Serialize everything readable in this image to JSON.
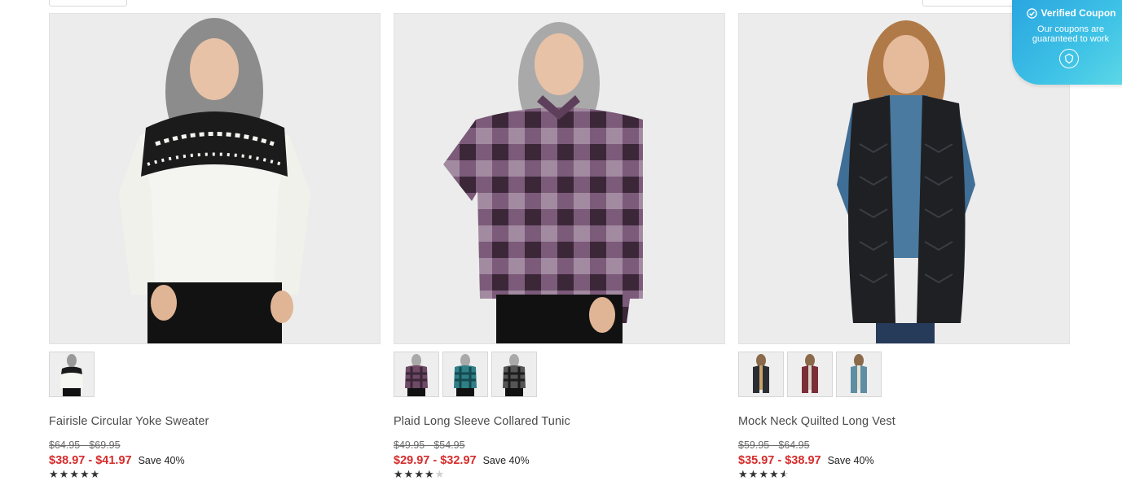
{
  "products": [
    {
      "title": "Fairisle Circular Yoke Sweater",
      "original_price": "$64.95 - $69.95",
      "sale_price": "$38.97 - $41.97",
      "save_text": "Save 40%",
      "rating": 5,
      "swatch_colors": [
        "#f2f2f2"
      ]
    },
    {
      "title": "Plaid Long Sleeve Collared Tunic",
      "original_price": "$49.95 - $54.95",
      "sale_price": "$29.97 - $32.97",
      "save_text": "Save 40%",
      "rating": 4,
      "swatch_colors": [
        "#6e4a66",
        "#2f7f86",
        "#3a3a3a"
      ]
    },
    {
      "title": "Mock Neck Quilted Long Vest",
      "original_price": "$59.95 - $64.95",
      "sale_price": "$35.97 - $38.97",
      "save_text": "Save 40%",
      "rating": 4.5,
      "swatch_colors": [
        "#2a2d32",
        "#7a2e36",
        "#5d8ea3"
      ]
    }
  ],
  "coupon_badge": {
    "title": "Verified Coupon",
    "subtitle_line1": "Our coupons are",
    "subtitle_line2": "guaranteed to work",
    "icon": "shield-check-icon"
  }
}
